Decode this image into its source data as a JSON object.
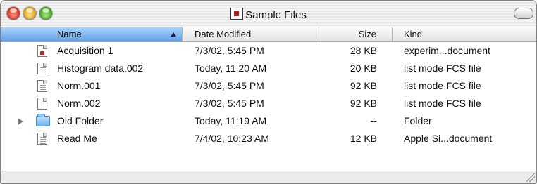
{
  "window": {
    "title": "Sample Files"
  },
  "columns": {
    "name": "Name",
    "date": "Date Modified",
    "size": "Size",
    "kind": "Kind"
  },
  "rows": [
    {
      "name": "Acquisition 1",
      "date": "7/3/02, 5:45 PM",
      "size": "28 KB",
      "kind": "experim...document",
      "icon": "experiment-document-icon"
    },
    {
      "name": "Histogram data.002",
      "date": "Today, 11:20 AM",
      "size": "20 KB",
      "kind": "list mode FCS file",
      "icon": "fcs-file-icon"
    },
    {
      "name": "Norm.001",
      "date": "7/3/02, 5:45 PM",
      "size": "92 KB",
      "kind": "list mode FCS file",
      "icon": "fcs-file-icon"
    },
    {
      "name": "Norm.002",
      "date": "7/3/02, 5:45 PM",
      "size": "92 KB",
      "kind": "list mode FCS file",
      "icon": "fcs-file-icon"
    },
    {
      "name": "Old Folder",
      "date": "Today, 11:19 AM",
      "size": "--",
      "kind": "Folder",
      "icon": "folder-icon"
    },
    {
      "name": "Read Me",
      "date": "7/4/02, 10:23 AM",
      "size": "12 KB",
      "kind": "Apple Si...document",
      "icon": "text-document-icon"
    }
  ],
  "colors": {
    "selected_column_header": "#5f9fe6",
    "close_button": "#d8321f",
    "minimize_button": "#e0a010",
    "zoom_button": "#3fa21f"
  }
}
